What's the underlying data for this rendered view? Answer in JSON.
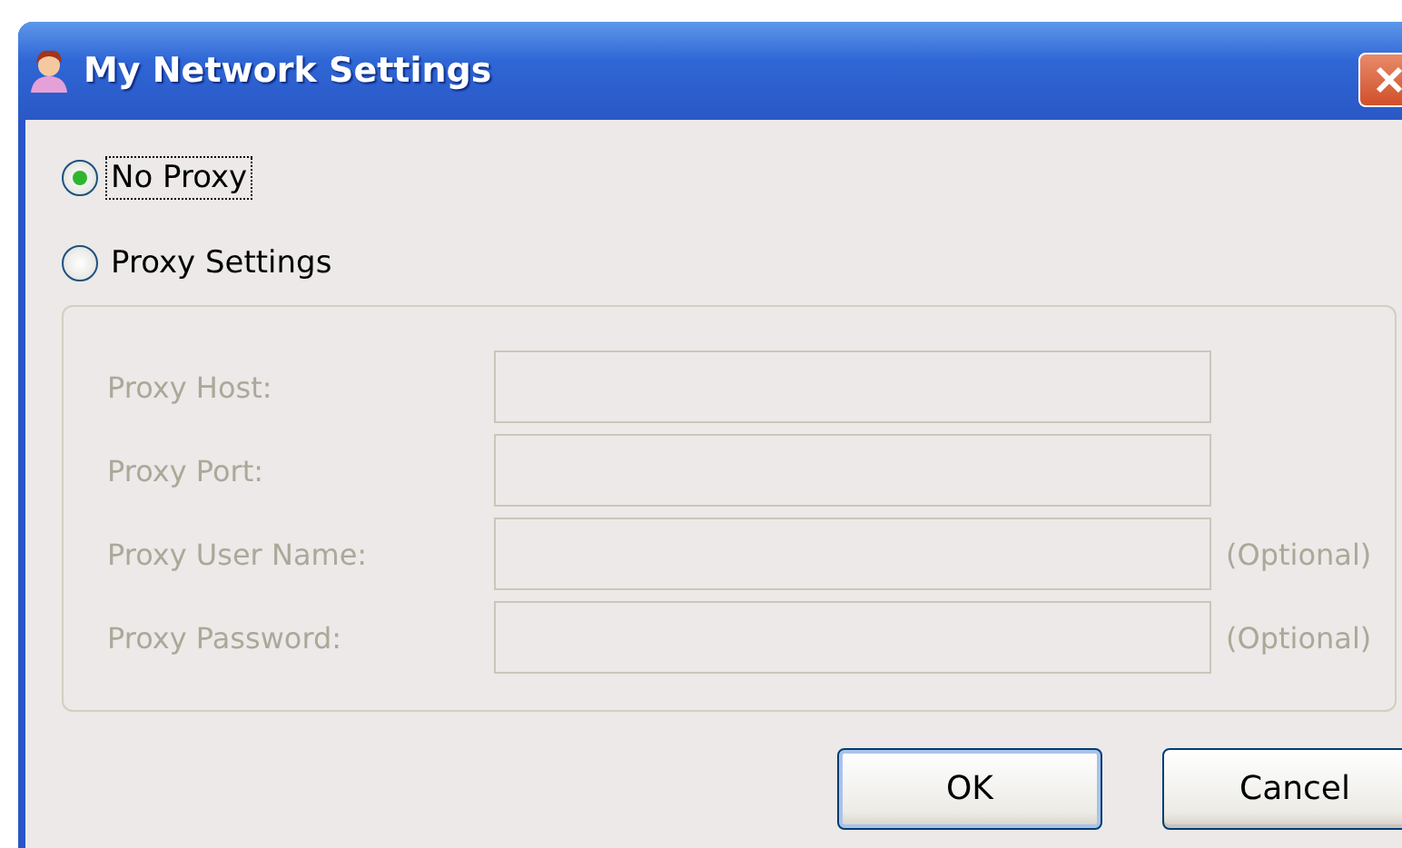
{
  "window": {
    "title": "My Network Settings"
  },
  "options": [
    {
      "label": "No Proxy",
      "selected": true,
      "focused": true
    },
    {
      "label": "Proxy Settings",
      "selected": false,
      "focused": false
    }
  ],
  "proxy_fields": [
    {
      "label": "Proxy Host:",
      "disabled": true
    },
    {
      "label": "Proxy Port:",
      "disabled": true
    },
    {
      "label": "Proxy User Name:",
      "disabled": true,
      "note": "(Optional)"
    },
    {
      "label": "Proxy Password:",
      "disabled": true,
      "note": "(Optional)"
    }
  ],
  "buttons": [
    {
      "label": "OK",
      "kind": "primary"
    },
    {
      "label": "Cancel",
      "kind": "normal"
    }
  ]
}
